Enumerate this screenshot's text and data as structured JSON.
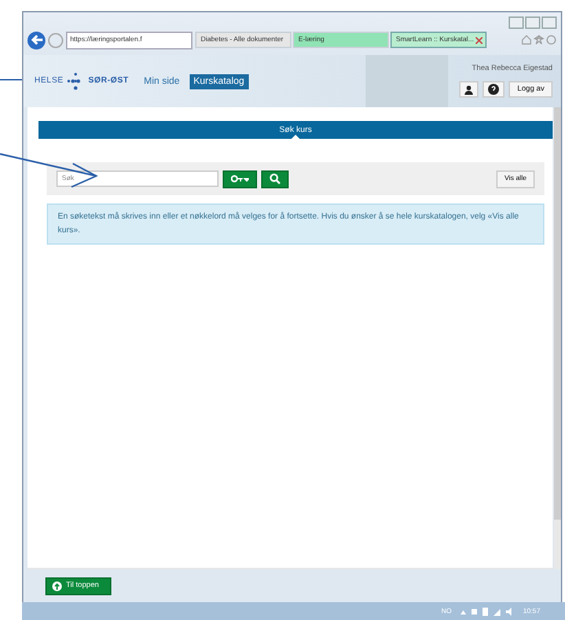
{
  "browser": {
    "address": "https://læringsportalen.f",
    "tabs": [
      {
        "label": "Diabetes - Alle dokumenter",
        "selected": false,
        "color": "#e6e6e6"
      },
      {
        "label": "E-læring",
        "selected": false,
        "color": "#8fe3b4"
      },
      {
        "label": "SmartLearn :: Kurskatal...",
        "selected": true,
        "color": "#b9edcf"
      }
    ]
  },
  "header": {
    "logo": [
      "HELSE",
      "SØR-ØST"
    ],
    "nav": [
      {
        "label": "Min side",
        "selected": false
      },
      {
        "label": "Kurskatalog",
        "selected": true
      }
    ],
    "user": "Thea Rebecca Eigestad",
    "logout": "Logg av"
  },
  "section": {
    "title": "Søk kurs",
    "search": {
      "placeholder": "Søk"
    },
    "show_all": "Vis alle",
    "info": "En søketekst må skrives inn eller et nøkkelord må velges for å fortsette. Hvis du ønsker å se hele kurskatalogen, velg «Vis alle kurs»."
  },
  "footer": {
    "button": "Til toppen"
  },
  "taskbar": {
    "language": "NO",
    "time": "10:57"
  }
}
